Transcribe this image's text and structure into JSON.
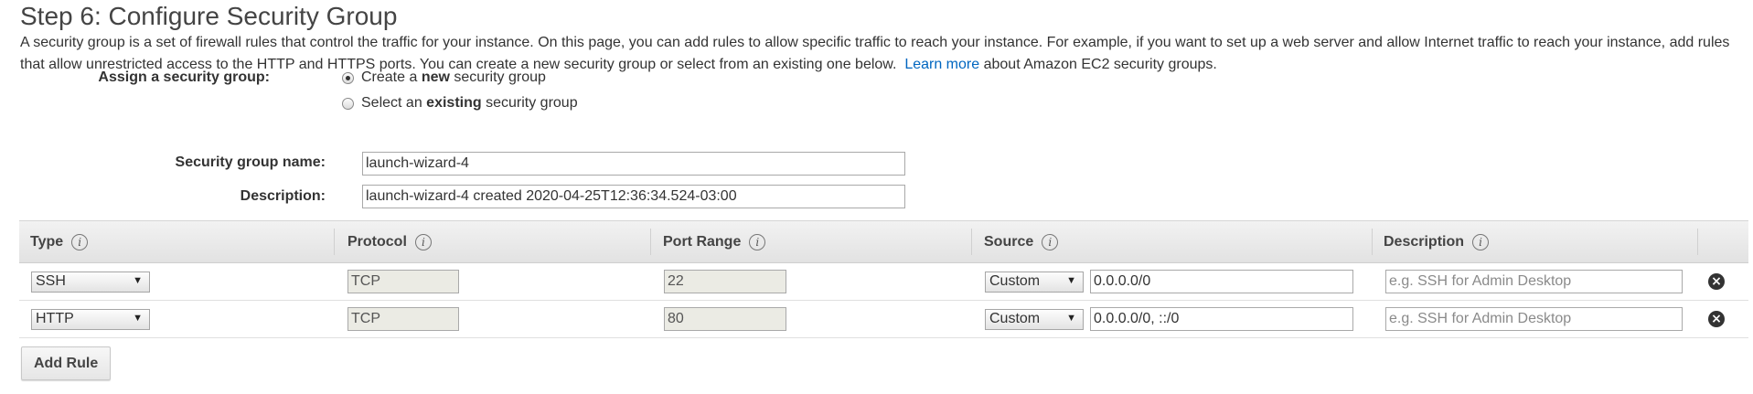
{
  "step_title": "Step 6: Configure Security Group",
  "intro": {
    "text": "A security group is a set of firewall rules that control the traffic for your instance. On this page, you can add rules to allow specific traffic to reach your instance. For example, if you want to set up a web server and allow Internet traffic to reach your instance, add rules that allow unrestricted access to the HTTP and HTTPS ports. You can create a new security group or select from an existing one below.",
    "link": "Learn more",
    "after_link": "about Amazon EC2 security groups."
  },
  "assign": {
    "label": "Assign a security group:",
    "option_new": {
      "prefix": "Create a",
      "bold": "new",
      "suffix": "security group",
      "selected": true
    },
    "option_existing": {
      "prefix": "Select an",
      "bold": "existing",
      "suffix": "security group",
      "selected": false
    }
  },
  "group_name": {
    "label": "Security group name:",
    "value": "launch-wizard-4"
  },
  "group_description": {
    "label": "Description:",
    "value": "launch-wizard-4 created 2020-04-25T12:36:34.524-03:00"
  },
  "table": {
    "headers": {
      "type": "Type",
      "protocol": "Protocol",
      "port_range": "Port Range",
      "source": "Source",
      "description": "Description"
    },
    "info_glyph": "i",
    "rows": [
      {
        "type": "SSH",
        "protocol": "TCP",
        "port_range": "22",
        "source_mode": "Custom",
        "source_value": "0.0.0.0/0",
        "description_placeholder": "e.g. SSH for Admin Desktop"
      },
      {
        "type": "HTTP",
        "protocol": "TCP",
        "port_range": "80",
        "source_mode": "Custom",
        "source_value": "0.0.0.0/0, ::/0",
        "description_placeholder": "e.g. SSH for Admin Desktop"
      }
    ]
  },
  "add_rule_label": "Add Rule",
  "icons": {
    "info": "info-icon",
    "remove": "remove-rule-icon",
    "dropdown": "dropdown-arrow-icon"
  },
  "colors": {
    "link": "#0066c0",
    "header_bg": "#e8e8e8",
    "readonly_bg": "#ebebe4"
  }
}
